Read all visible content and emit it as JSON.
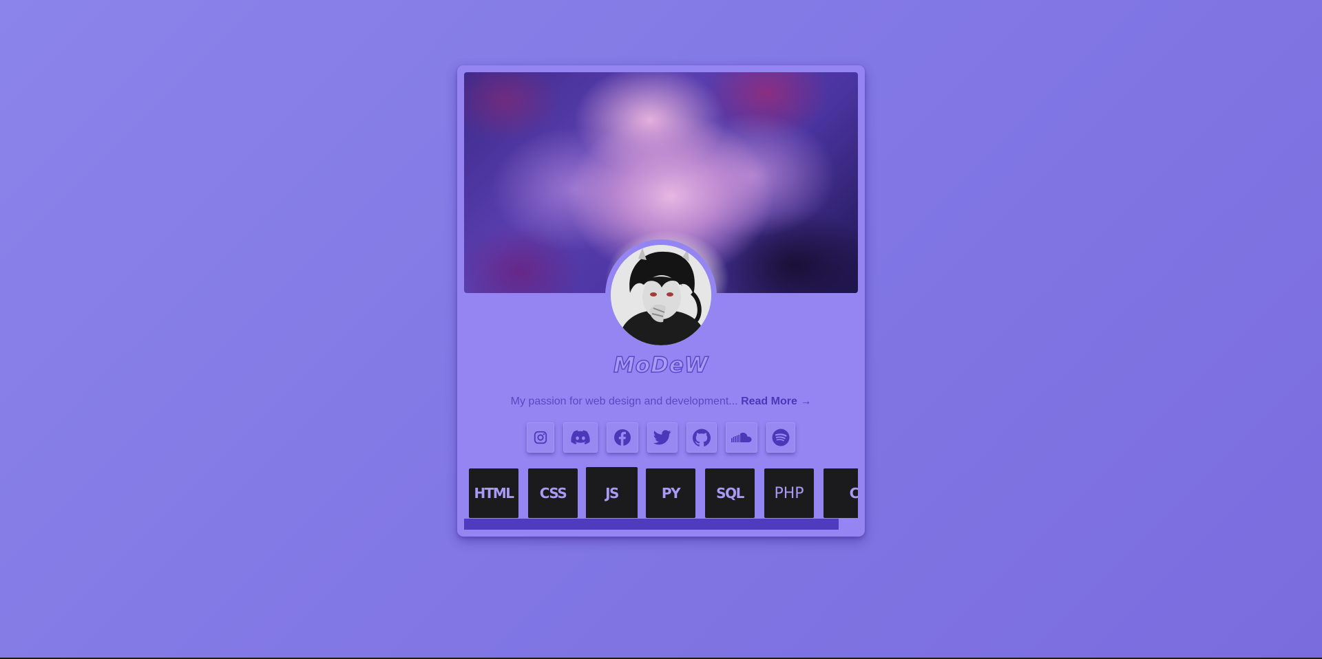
{
  "profile": {
    "name": "MoDeW",
    "bio_text": "My passion for web design and development... ",
    "read_more": "Read More →"
  },
  "socials": [
    {
      "name": "instagram-icon"
    },
    {
      "name": "discord-icon"
    },
    {
      "name": "facebook-icon"
    },
    {
      "name": "twitter-icon"
    },
    {
      "name": "github-icon"
    },
    {
      "name": "soundcloud-icon"
    },
    {
      "name": "spotify-icon"
    }
  ],
  "skills": [
    "HTML",
    "CSS",
    "JS",
    "PY",
    "SQL",
    "PHP",
    "C#"
  ],
  "colors": {
    "background": "#8176e4",
    "card": "#9585f2",
    "accent": "#5b47c9",
    "skill_tile": "#1b1b1d",
    "scrollbar": "#4f3bbd"
  }
}
